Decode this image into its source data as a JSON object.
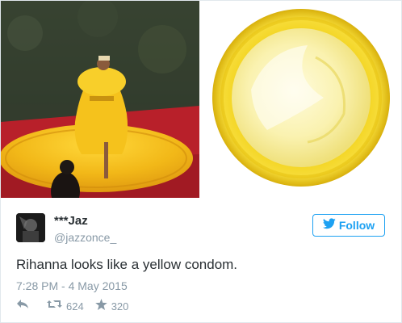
{
  "photos": {
    "left_alt": "",
    "right_alt": ""
  },
  "tweet": {
    "display_name": "***Jaz",
    "handle": "@jazzonce_",
    "follow_label": "Follow",
    "text": "Rihanna looks like a yellow condom.",
    "timestamp": "7:28 PM - 4 May 2015",
    "retweet_count": "624",
    "favorite_count": "320"
  },
  "icons": {
    "follow": "twitter-bird-icon",
    "reply": "reply-icon",
    "retweet": "retweet-icon",
    "favorite": "star-icon"
  },
  "colors": {
    "accent": "#1da1f2",
    "text": "#292f33",
    "muted": "#8899a6",
    "border": "#e1e8ed"
  }
}
